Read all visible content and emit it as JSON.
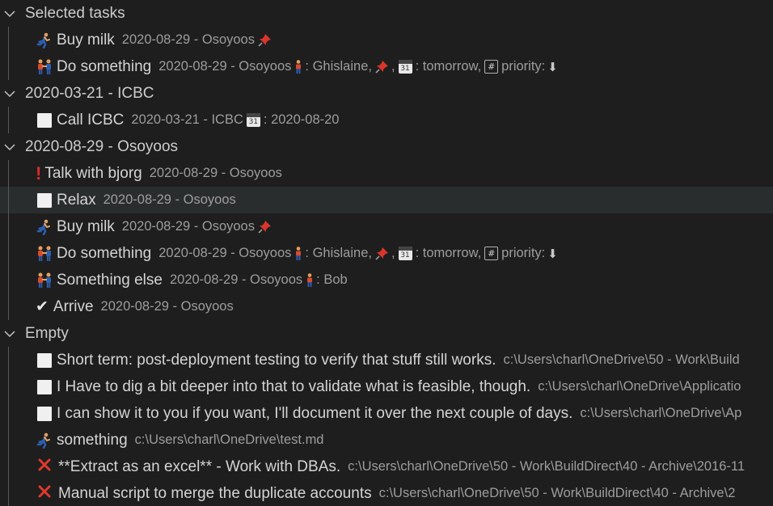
{
  "groups": [
    {
      "label": "Selected tasks",
      "tasks": [
        {
          "type": "runner",
          "label": "Buy milk",
          "desc": "2020-08-29 - Osoyoos",
          "pin": true
        },
        {
          "type": "people",
          "label": "Do something",
          "desc": "2020-08-29 - Osoyoos",
          "assignee": ": Ghislaine,",
          "comma_after_pin": ",",
          "due_sep": ": tomorrow,",
          "priority": "priority:",
          "cal_day": "31"
        }
      ]
    },
    {
      "label": "2020-03-21 - ICBC",
      "tasks": [
        {
          "type": "checkbox",
          "label": "Call ICBC",
          "desc": "2020-03-21 - ICBC",
          "due": ": 2020-08-20",
          "cal_day": "31"
        }
      ]
    },
    {
      "label": "2020-08-29 - Osoyoos",
      "tasks": [
        {
          "type": "bang",
          "label": "Talk with bjorg",
          "desc": "2020-08-29 - Osoyoos"
        },
        {
          "type": "checkbox",
          "label": "Relax",
          "desc": "2020-08-29 - Osoyoos"
        },
        {
          "type": "runner",
          "label": "Buy milk",
          "desc": "2020-08-29 - Osoyoos"
        },
        {
          "type": "people",
          "label": "Do something",
          "desc": "2020-08-29 - Osoyoos",
          "assignee": ": Ghislaine,",
          "comma_after_pin": ",",
          "due_sep": ": tomorrow,",
          "priority": "priority:",
          "cal_day": "31"
        },
        {
          "type": "people",
          "label": "Something else",
          "desc": "2020-08-29 - Osoyoos",
          "assignee": ": Bob"
        },
        {
          "type": "done",
          "label": "Arrive",
          "desc": "2020-08-29 - Osoyoos"
        }
      ]
    },
    {
      "label": "Empty",
      "tasks": [
        {
          "type": "checkbox",
          "label": "Short term: post-deployment testing to verify that stuff still works.",
          "desc": "c:\\Users\\charl\\OneDrive\\50 - Work\\Build"
        },
        {
          "type": "checkbox",
          "label": "I Have to dig a bit deeper into that to validate what is feasible, though.",
          "desc": "c:\\Users\\charl\\OneDrive\\Applicatio"
        },
        {
          "type": "checkbox",
          "label": "I can show it to you if you want, I'll document it over the next couple of days.",
          "desc": "c:\\Users\\charl\\OneDrive\\Ap"
        },
        {
          "type": "runner",
          "label": "something",
          "desc": "c:\\Users\\charl\\OneDrive\\test.md"
        },
        {
          "type": "cancel",
          "label": "**Extract as an excel** - Work with DBAs.",
          "desc": "c:\\Users\\charl\\OneDrive\\50 - Work\\BuildDirect\\40 - Archive\\2016-11"
        },
        {
          "type": "cancel",
          "label": "Manual script to merge the duplicate accounts",
          "desc": "c:\\Users\\charl\\OneDrive\\50 - Work\\BuildDirect\\40 - Archive\\2"
        }
      ]
    }
  ],
  "colors": {
    "background": "#1e1e1e",
    "selected_row": "#2a2d2e",
    "text": "#d4d4d4",
    "description": "#9d9d9d",
    "cancel": "#e0392b",
    "bang": "#e02a2a"
  }
}
